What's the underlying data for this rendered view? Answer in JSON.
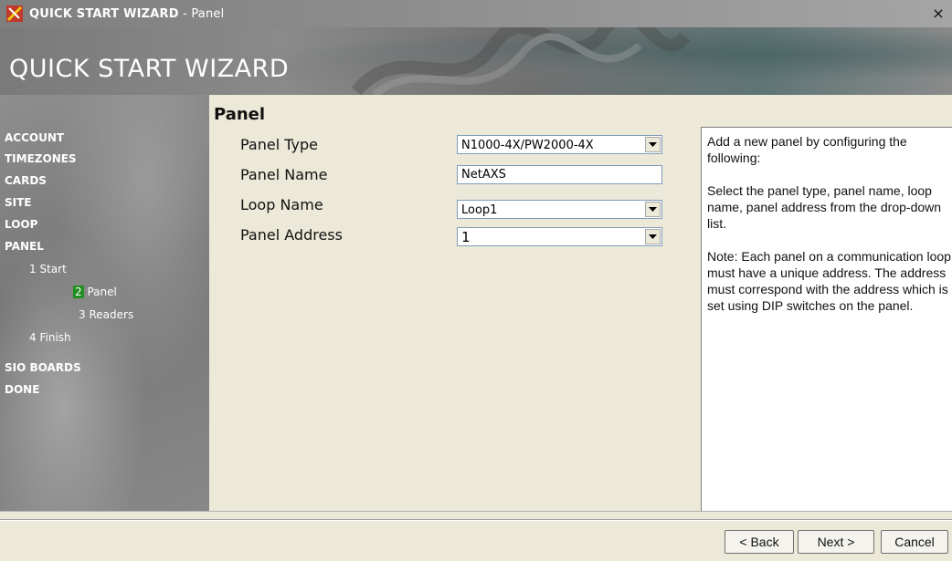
{
  "window": {
    "title_main": "QUICK START WIZARD",
    "title_sub": " - Panel",
    "close_symbol": "×",
    "icon": "app-wrench-icon"
  },
  "banner": {
    "title": "QUICK START WIZARD"
  },
  "sidebar": {
    "items": [
      {
        "label": "ACCOUNT"
      },
      {
        "label": "TIMEZONES"
      },
      {
        "label": "CARDS"
      },
      {
        "label": "SITE"
      },
      {
        "label": "LOOP"
      },
      {
        "label": "PANEL"
      },
      {
        "label": "SIO BOARDS"
      },
      {
        "label": "DONE"
      }
    ],
    "sub_items": [
      {
        "num": "1",
        "label": "Start"
      },
      {
        "num": "2",
        "label": "Panel",
        "active": true
      },
      {
        "num": "3",
        "label": "Readers"
      },
      {
        "num": "4",
        "label": "Finish"
      }
    ],
    "active_color": "#1f8f1f"
  },
  "form": {
    "section_title": "Panel",
    "panel_type": {
      "label": "Panel Type",
      "value": "N1000-4X/PW2000-4X"
    },
    "panel_name": {
      "label": "Panel Name",
      "value": "NetAXS"
    },
    "loop_name": {
      "label": "Loop Name",
      "value": "Loop1"
    },
    "panel_address": {
      "label": "Panel Address",
      "value": "1"
    }
  },
  "help": {
    "p1": "Add a new panel by configuring the following:",
    "p2": "Select the panel type, panel name, loop name, panel address from the drop-down list.",
    "p3": "Note: Each panel on a communication loop must have a unique address. The address must correspond with the address which is set using DIP switches on the panel."
  },
  "buttons": {
    "back": "< Back",
    "next": "Next >",
    "cancel": "Cancel"
  }
}
